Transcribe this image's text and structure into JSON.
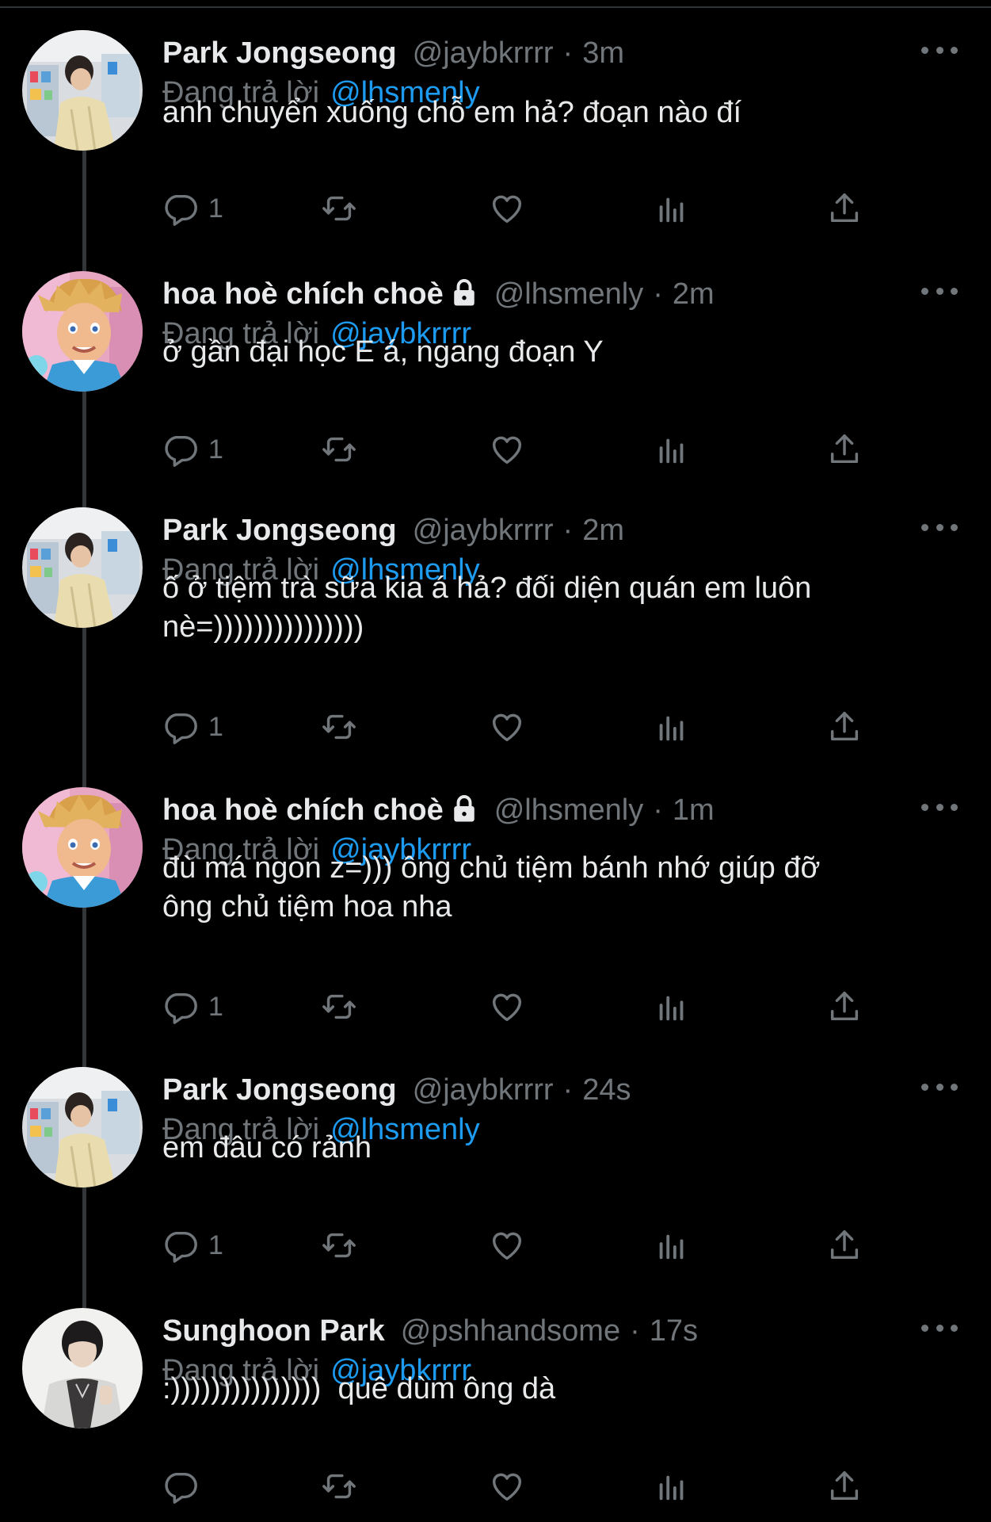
{
  "colors": {
    "background": "#000000",
    "text": "#e7e9ea",
    "muted": "#71767b",
    "mention": "#1d9bf0",
    "divider": "#2f3336"
  },
  "reply_prefix": "Đang trả lời",
  "action_icons": [
    "reply-icon",
    "retweet-icon",
    "like-icon",
    "views-icon",
    "share-icon"
  ],
  "tweets": [
    {
      "name": "Park Jongseong",
      "locked": false,
      "handle": "@jaybkrrrr",
      "time": "3m",
      "replying_to": "@lhsmenly",
      "lines": [
        "anh chuyển xuống chỗ em hả? đoạn nào đí"
      ],
      "reply_count": "1",
      "avatar": "jongseong"
    },
    {
      "name": "hoa hoè chích choè",
      "locked": true,
      "handle": "@lhsmenly",
      "time": "2m",
      "replying_to": "@jaybkrrrr",
      "lines": [
        "ở gần đại học E á, ngang đoạn Y"
      ],
      "reply_count": "1",
      "avatar": "ken"
    },
    {
      "name": "Park Jongseong",
      "locked": false,
      "handle": "@jaybkrrrr",
      "time": "2m",
      "replying_to": "@lhsmenly",
      "lines": [
        "ố ở tiệm trà sữa kia á hả? đối diện quán em luôn",
        "nè=)))))))))))))))"
      ],
      "reply_count": "1",
      "avatar": "jongseong"
    },
    {
      "name": "hoa hoè chích choè",
      "locked": true,
      "handle": "@lhsmenly",
      "time": "1m",
      "replying_to": "@jaybkrrrr",
      "lines": [
        "đù má ngon z=))) ông chủ tiệm bánh nhớ giúp đỡ",
        "ông chủ tiệm hoa nha"
      ],
      "reply_count": "1",
      "avatar": "ken"
    },
    {
      "name": "Park Jongseong",
      "locked": false,
      "handle": "@jaybkrrrr",
      "time": "24s",
      "replying_to": "@lhsmenly",
      "lines": [
        "em đâu có rảnh"
      ],
      "reply_count": "1",
      "avatar": "jongseong"
    },
    {
      "name": "Sunghoon Park",
      "locked": false,
      "handle": "@pshhandsome",
      "time": "17s",
      "replying_to": "@jaybkrrrr",
      "lines": [
        ":)))))))))))))))  quê dùm ông dà"
      ],
      "reply_count": "",
      "avatar": "sunghoon"
    }
  ]
}
